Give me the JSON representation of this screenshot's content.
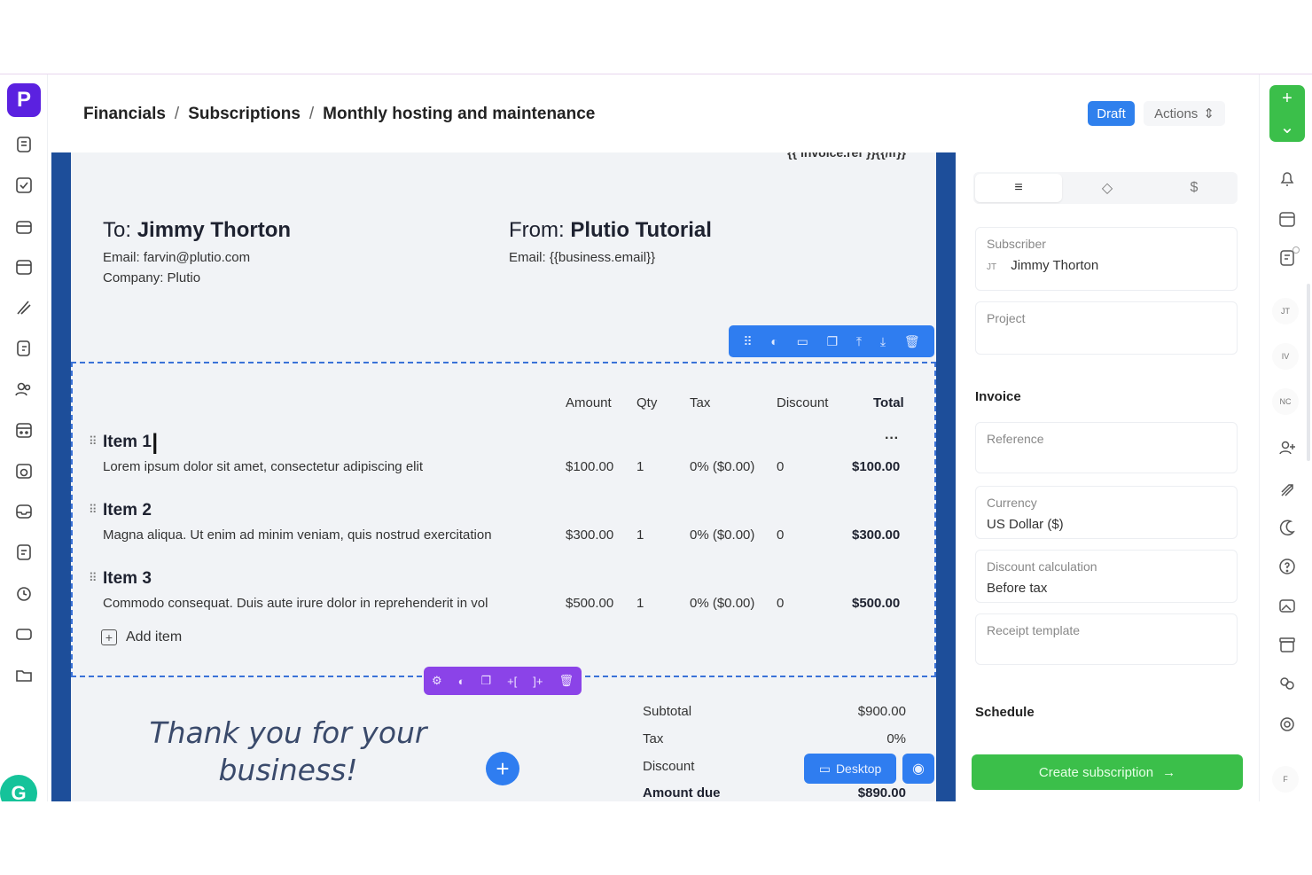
{
  "breadcrumb": {
    "part1": "Financials",
    "part2": "Subscriptions",
    "part3": "Monthly hosting and maintenance",
    "sep": "/"
  },
  "status": {
    "draft": "Draft",
    "actions": "Actions"
  },
  "invoice": {
    "ref_text": "{{ invoice.ref }}{{/if}}",
    "to": {
      "prefix": "To:",
      "name": "Jimmy Thorton",
      "email": "Email: farvin@plutio.com",
      "company": "Company: Plutio"
    },
    "from": {
      "prefix": "From:",
      "name": "Plutio Tutorial",
      "email": "Email: {{business.email}}"
    },
    "columns": {
      "amount": "Amount",
      "qty": "Qty",
      "tax": "Tax",
      "discount": "Discount",
      "total": "Total"
    },
    "items": [
      {
        "name": "Item 1",
        "desc": "Lorem ipsum dolor sit amet, consectetur adipiscing elit",
        "amount": "$100.00",
        "qty": "1",
        "tax": "0% ($0.00)",
        "discount": "0",
        "total": "$100.00"
      },
      {
        "name": "Item 2",
        "desc": "Magna aliqua. Ut enim ad minim veniam, quis nostrud exercitation",
        "amount": "$300.00",
        "qty": "1",
        "tax": "0% ($0.00)",
        "discount": "0",
        "total": "$300.00"
      },
      {
        "name": "Item 3",
        "desc": "Commodo consequat. Duis aute irure dolor in reprehenderit in vol",
        "amount": "$500.00",
        "qty": "1",
        "tax": "0% ($0.00)",
        "discount": "0",
        "total": "$500.00"
      }
    ],
    "add_item": "Add item",
    "thanks": "Thank you for your business!",
    "summary": {
      "subtotal_label": "Subtotal",
      "subtotal": "$900.00",
      "tax_label": "Tax",
      "tax": "0%",
      "discount_label": "Discount",
      "amount_due_label": "Amount due",
      "amount_due": "$890.00"
    },
    "desktop_label": "Desktop"
  },
  "panel": {
    "subscriber_label": "Subscriber",
    "subscriber_initials": "JT",
    "subscriber_value": "Jimmy Thorton",
    "project_label": "Project",
    "invoice_section": "Invoice",
    "reference_label": "Reference",
    "currency_label": "Currency",
    "currency_value": "US Dollar ($)",
    "discount_calc_label": "Discount calculation",
    "discount_calc_value": "Before tax",
    "receipt_label": "Receipt template",
    "schedule_section": "Schedule",
    "create_button": "Create subscription"
  },
  "rail": {
    "tag1": "JT",
    "tag2": "IV",
    "tag3": "NC",
    "bottom": "F"
  },
  "icons": [
    "logo",
    "notes-icon",
    "check-icon",
    "briefcase-icon",
    "calendar-icon",
    "pen-icon",
    "proposal-icon",
    "people-icon",
    "calendar-grid-icon",
    "clock-calendar-icon",
    "inbox-icon",
    "doc-icon",
    "timer-icon",
    "card-icon",
    "folder-icon"
  ],
  "colors": {
    "brand": "#5b21e0",
    "canvas_border": "#1d4e9a",
    "accent_blue": "#2f7df0",
    "green": "#3bbf4a",
    "purple_toolbar": "#8b43e8"
  }
}
